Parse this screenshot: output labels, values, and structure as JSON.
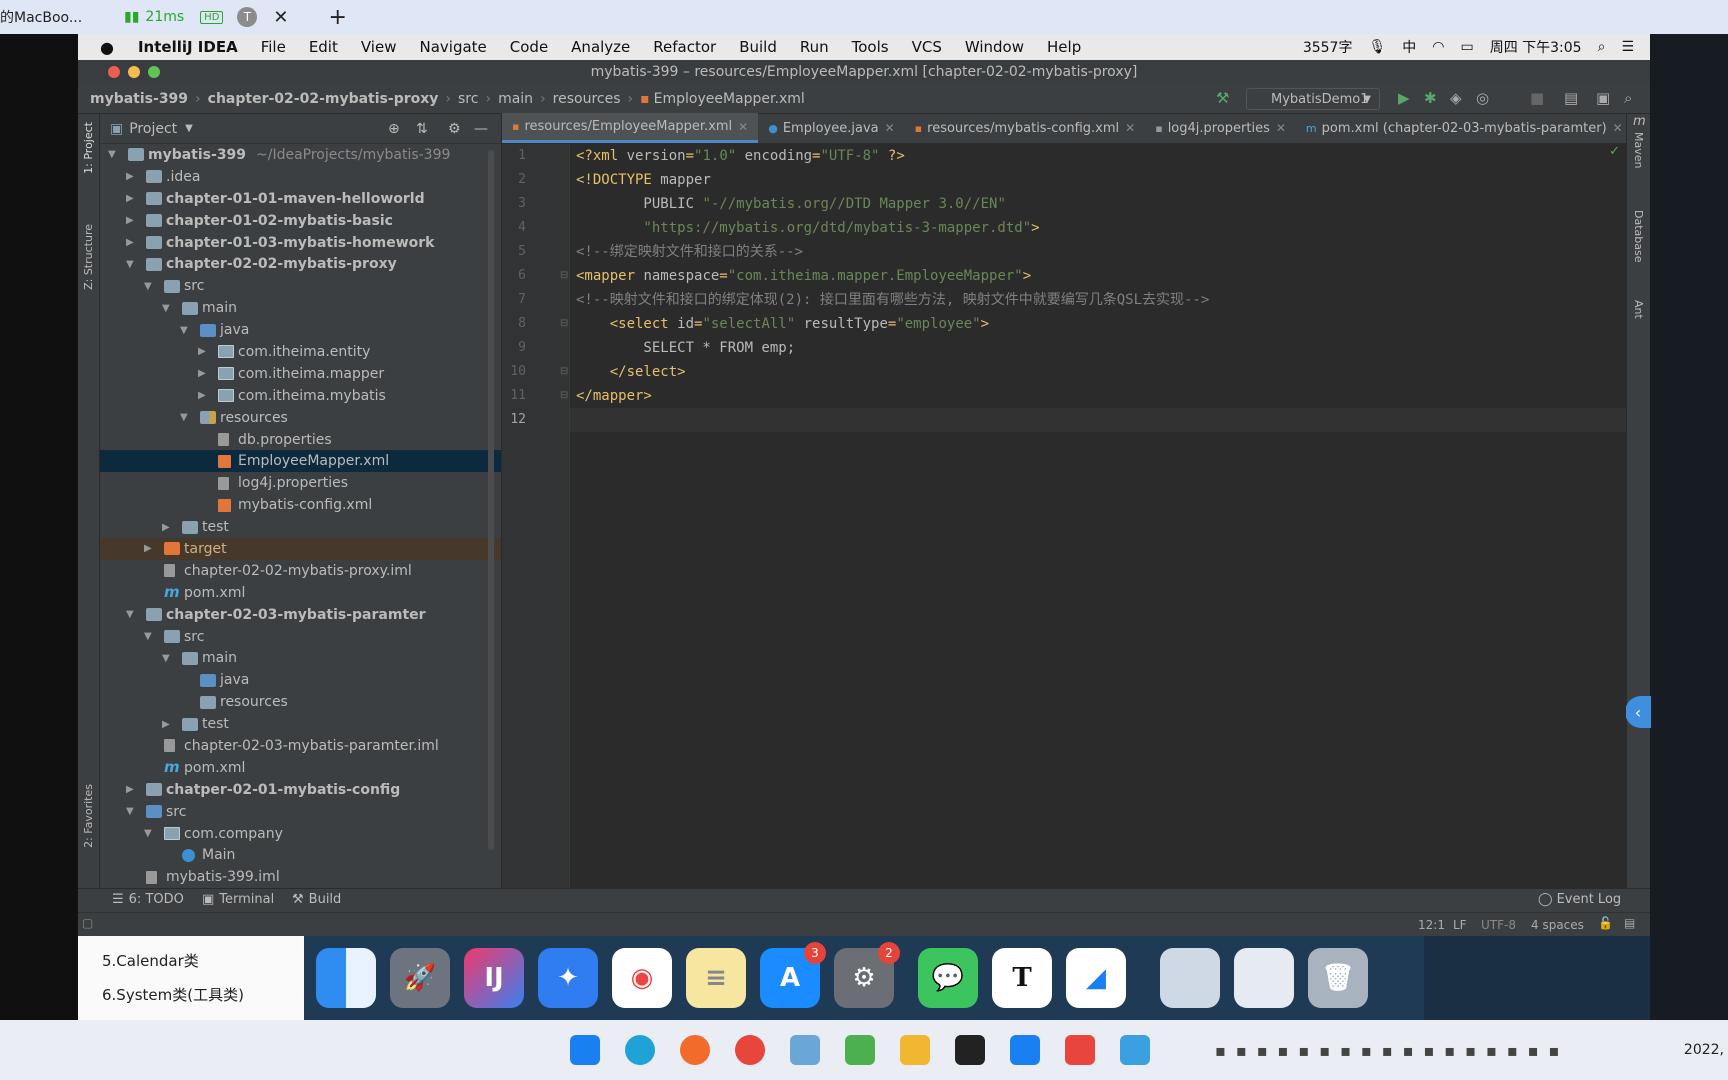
{
  "browser_bar": {
    "tab_title": "的MacBoo...",
    "ping": "21ms",
    "hd": "HD",
    "avatar_letter": "T",
    "close": "✕",
    "new_tab": "+"
  },
  "mac_menu": {
    "app_name": "IntelliJ IDEA",
    "items": [
      "File",
      "Edit",
      "View",
      "Navigate",
      "Code",
      "Analyze",
      "Refactor",
      "Build",
      "Run",
      "Tools",
      "VCS",
      "Window",
      "Help"
    ],
    "word_count": "3557字",
    "ime": "中",
    "datetime": "周四 下午3:05"
  },
  "window_title": "mybatis-399 – resources/EmployeeMapper.xml [chapter-02-02-mybatis-proxy]",
  "breadcrumb": [
    "mybatis-399",
    "chapter-02-02-mybatis-proxy",
    "src",
    "main",
    "resources",
    "EmployeeMapper.xml"
  ],
  "run_config": "MybatisDemo1",
  "left_strip": {
    "project": "1: Project",
    "structure": "Z: Structure",
    "favorites": "2: Favorites"
  },
  "right_strip": {
    "maven": "Maven",
    "database": "Database",
    "ant": "Ant"
  },
  "project_panel": {
    "title": "Project",
    "tree": [
      {
        "label": "mybatis-399",
        "extra": "~/IdeaProjects/mybatis-399",
        "indent": 0,
        "arrow": "down",
        "icon": "folder",
        "bold": true
      },
      {
        "label": ".idea",
        "indent": 1,
        "arrow": "right",
        "icon": "folder"
      },
      {
        "label": "chapter-01-01-maven-helloworld",
        "indent": 1,
        "arrow": "right",
        "icon": "folder",
        "bold": true
      },
      {
        "label": "chapter-01-02-mybatis-basic",
        "indent": 1,
        "arrow": "right",
        "icon": "folder",
        "bold": true
      },
      {
        "label": "chapter-01-03-mybatis-homework",
        "indent": 1,
        "arrow": "right",
        "icon": "folder",
        "bold": true
      },
      {
        "label": "chapter-02-02-mybatis-proxy",
        "indent": 1,
        "arrow": "down",
        "icon": "folder",
        "bold": true
      },
      {
        "label": "src",
        "indent": 2,
        "arrow": "down",
        "icon": "folder"
      },
      {
        "label": "main",
        "indent": 3,
        "arrow": "down",
        "icon": "folder"
      },
      {
        "label": "java",
        "indent": 4,
        "arrow": "down",
        "icon": "src"
      },
      {
        "label": "com.itheima.entity",
        "indent": 5,
        "arrow": "right",
        "icon": "pkg"
      },
      {
        "label": "com.itheima.mapper",
        "indent": 5,
        "arrow": "right",
        "icon": "pkg"
      },
      {
        "label": "com.itheima.mybatis",
        "indent": 5,
        "arrow": "right",
        "icon": "pkg"
      },
      {
        "label": "resources",
        "indent": 4,
        "arrow": "down",
        "icon": "res"
      },
      {
        "label": "db.properties",
        "indent": 5,
        "arrow": "",
        "icon": "file"
      },
      {
        "label": "EmployeeMapper.xml",
        "indent": 5,
        "arrow": "",
        "icon": "xml",
        "selected": true
      },
      {
        "label": "log4j.properties",
        "indent": 5,
        "arrow": "",
        "icon": "file"
      },
      {
        "label": "mybatis-config.xml",
        "indent": 5,
        "arrow": "",
        "icon": "xml"
      },
      {
        "label": "test",
        "indent": 3,
        "arrow": "right",
        "icon": "folder"
      },
      {
        "label": "target",
        "indent": 2,
        "arrow": "right",
        "icon": "target",
        "target": true
      },
      {
        "label": "chapter-02-02-mybatis-proxy.iml",
        "indent": 2,
        "arrow": "",
        "icon": "file"
      },
      {
        "label": "pom.xml",
        "indent": 2,
        "arrow": "",
        "icon": "m"
      },
      {
        "label": "chapter-02-03-mybatis-paramter",
        "indent": 1,
        "arrow": "down",
        "icon": "folder",
        "bold": true
      },
      {
        "label": "src",
        "indent": 2,
        "arrow": "down",
        "icon": "folder"
      },
      {
        "label": "main",
        "indent": 3,
        "arrow": "down",
        "icon": "folder"
      },
      {
        "label": "java",
        "indent": 4,
        "arrow": "",
        "icon": "src"
      },
      {
        "label": "resources",
        "indent": 4,
        "arrow": "",
        "icon": "folder"
      },
      {
        "label": "test",
        "indent": 3,
        "arrow": "right",
        "icon": "folder"
      },
      {
        "label": "chapter-02-03-mybatis-paramter.iml",
        "indent": 2,
        "arrow": "",
        "icon": "file"
      },
      {
        "label": "pom.xml",
        "indent": 2,
        "arrow": "",
        "icon": "m"
      },
      {
        "label": "chatper-02-01-mybatis-config",
        "indent": 1,
        "arrow": "right",
        "icon": "folder",
        "bold": true
      },
      {
        "label": "src",
        "indent": 1,
        "arrow": "down",
        "icon": "src"
      },
      {
        "label": "com.company",
        "indent": 2,
        "arrow": "down",
        "icon": "pkg"
      },
      {
        "label": "Main",
        "indent": 3,
        "arrow": "",
        "icon": "class"
      },
      {
        "label": "mybatis-399.iml",
        "indent": 1,
        "arrow": "",
        "icon": "file"
      }
    ]
  },
  "editor_tabs": [
    {
      "label": "resources/EmployeeMapper.xml",
      "icon": "xml",
      "active": true
    },
    {
      "label": "Employee.java",
      "icon": "class"
    },
    {
      "label": "resources/mybatis-config.xml",
      "icon": "xml"
    },
    {
      "label": "log4j.properties",
      "icon": "file"
    },
    {
      "label": "pom.xml (chapter-02-03-mybatis-paramter)",
      "icon": "m"
    }
  ],
  "code_lines": [
    {
      "n": "1",
      "segs": [
        [
          "k",
          "<?xml "
        ],
        [
          "an",
          "version"
        ],
        [
          "k",
          "="
        ],
        [
          "av",
          "\"1.0\""
        ],
        [
          "an",
          " encoding"
        ],
        [
          "k",
          "="
        ],
        [
          "av",
          "\"UTF-8\""
        ],
        [
          "k",
          " ?>"
        ]
      ]
    },
    {
      "n": "2",
      "segs": [
        [
          "k",
          "<!DOCTYPE "
        ],
        [
          "an",
          "mapper"
        ]
      ]
    },
    {
      "n": "3",
      "segs": [
        [
          "an",
          "        PUBLIC "
        ],
        [
          "av",
          "\"-//mybatis.org//DTD Mapper 3.0//EN\""
        ]
      ]
    },
    {
      "n": "4",
      "segs": [
        [
          "av",
          "        \"https://mybatis.org/dtd/mybatis-3-mapper.dtd\""
        ],
        [
          "k",
          ">"
        ]
      ]
    },
    {
      "n": "5",
      "segs": [
        [
          "cm",
          "<!--绑定映射文件和接口的关系-->"
        ]
      ]
    },
    {
      "n": "6",
      "segs": [
        [
          "k",
          "<mapper "
        ],
        [
          "an",
          "namespace"
        ],
        [
          "k",
          "="
        ],
        [
          "av",
          "\"com.itheima.mapper.EmployeeMapper\""
        ],
        [
          "k",
          ">"
        ]
      ]
    },
    {
      "n": "7",
      "segs": [
        [
          "cm",
          "<!--映射文件和接口的绑定体现(2): 接口里面有哪些方法, 映射文件中就要编写几条QSL去实现-->"
        ]
      ]
    },
    {
      "n": "8",
      "segs": [
        [
          "k",
          "    <select "
        ],
        [
          "an",
          "id"
        ],
        [
          "k",
          "="
        ],
        [
          "av",
          "\"selectAll\""
        ],
        [
          "an",
          " resultType"
        ],
        [
          "k",
          "="
        ],
        [
          "av",
          "\"employee\""
        ],
        [
          "k",
          ">"
        ]
      ]
    },
    {
      "n": "9",
      "segs": [
        [
          "an",
          "        SELECT * FROM emp;"
        ]
      ]
    },
    {
      "n": "10",
      "segs": [
        [
          "k",
          "    </select>"
        ]
      ]
    },
    {
      "n": "11",
      "segs": [
        [
          "k",
          "</mapper>"
        ]
      ]
    },
    {
      "n": "12",
      "segs": []
    }
  ],
  "bottom_tools": {
    "todo": "6: TODO",
    "terminal": "Terminal",
    "build": "Build",
    "event_log": "Event Log"
  },
  "status": {
    "pos": "12:1",
    "lf": "LF",
    "enc": "UTF-8",
    "indent": "4 spaces"
  },
  "below_list": [
    "5.Calendar类",
    "6.System类(工具类)"
  ],
  "dock_badges": {
    "appstore": "3",
    "settings": "2"
  },
  "clock_fragment": "2022,",
  "colors": {
    "editor_bg": "#2b2b2b",
    "panel_bg": "#3c3f41",
    "selection": "#0d293e",
    "accent": "#4a88c7"
  }
}
